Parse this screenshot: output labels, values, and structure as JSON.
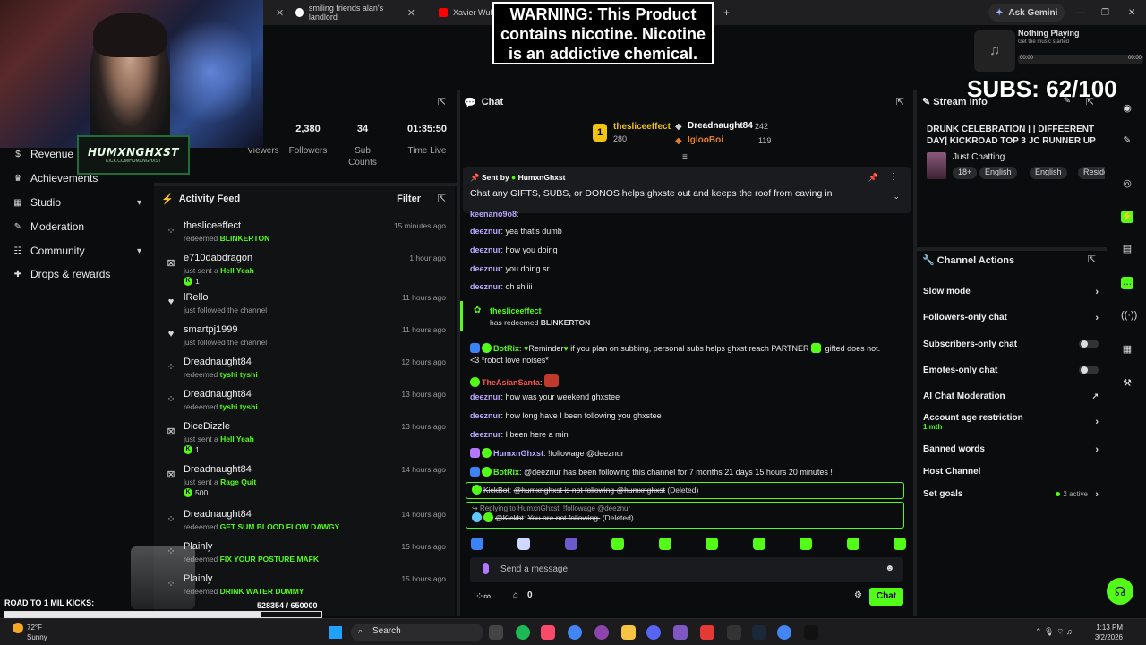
{
  "browser": {
    "tabs": [
      {
        "label": "smiling friends alan's landlord"
      },
      {
        "label": "Xavier Wulf"
      }
    ],
    "ask_gemini": "Ask Gemini"
  },
  "webcam": {
    "logo_text": "HUMXNGHXST",
    "logo_sub": "KICK.COM/HUMXNGHXST"
  },
  "warning_banner": {
    "text": "WARNING: This Product contains nicotine. Nicotine is an addictive chemical."
  },
  "music": {
    "title": "Nothing Playing",
    "subtitle": "Get the music started",
    "time_start": "00:00",
    "time_end": "00:00"
  },
  "subs_counter": "SUBS: 62/100",
  "sidebar": {
    "items": [
      {
        "label": "Revenue"
      },
      {
        "label": "Achievements"
      },
      {
        "label": "Studio"
      },
      {
        "label": "Moderation"
      },
      {
        "label": "Community"
      },
      {
        "label": "Drops & rewards"
      }
    ]
  },
  "stats": {
    "viewers_label": "Viewers",
    "followers_value": "2,380",
    "followers_label": "Followers",
    "subs_value": "34",
    "subs_label": "Sub Counts",
    "time_value": "01:35:50",
    "time_label": "Time Live"
  },
  "activity": {
    "title": "Activity Feed",
    "filter": "Filter",
    "items": [
      {
        "name": "thesliceeffect",
        "desc": "redeemed",
        "highlight": "BLINKERTON",
        "time": "15 minutes ago",
        "amount": ""
      },
      {
        "name": "e710dabdragon",
        "desc": "just sent a",
        "highlight": "Hell Yeah",
        "time": "1 hour ago",
        "amount": "1"
      },
      {
        "name": "lRello",
        "desc": "just followed the channel",
        "highlight": "",
        "time": "11 hours ago",
        "amount": ""
      },
      {
        "name": "smartpj1999",
        "desc": "just followed the channel",
        "highlight": "",
        "time": "11 hours ago",
        "amount": ""
      },
      {
        "name": "Dreadnaught84",
        "desc": "redeemed",
        "highlight": "tyshi tyshi",
        "time": "12 hours ago",
        "amount": ""
      },
      {
        "name": "Dreadnaught84",
        "desc": "redeemed",
        "highlight": "tyshi tyshi",
        "time": "13 hours ago",
        "amount": ""
      },
      {
        "name": "DiceDizzle",
        "desc": "just sent a",
        "highlight": "Hell Yeah",
        "time": "13 hours ago",
        "amount": "1"
      },
      {
        "name": "Dreadnaught84",
        "desc": "just sent a",
        "highlight": "Rage Quit",
        "time": "14 hours ago",
        "amount": "500"
      },
      {
        "name": "Dreadnaught84",
        "desc": "redeemed",
        "highlight": "GET SUM BLOOD FLOW DAWGY",
        "time": "14 hours ago",
        "amount": ""
      },
      {
        "name": "Plainly",
        "desc": "redeemed",
        "highlight": "FIX YOUR POSTURE MAFK",
        "time": "15 hours ago",
        "amount": ""
      },
      {
        "name": "Plainly",
        "desc": "redeemed",
        "highlight": "DRINK WATER DUMMY",
        "time": "15 hours ago",
        "amount": ""
      }
    ]
  },
  "road": {
    "label": "ROAD TO 1 MIL KICKS:",
    "count": "528354 / 650000",
    "progress": 0.81
  },
  "chat": {
    "title": "Chat",
    "leaderboard": [
      {
        "rank": "1",
        "name": "thesliceeffect",
        "value": "280"
      },
      {
        "name": "Dreadnaught84",
        "value": "242"
      },
      {
        "name": "IglooBoi",
        "value": "119"
      }
    ],
    "pinned": {
      "sent_by_label": "Sent by",
      "sent_by_user": "HumxnGhxst",
      "message": "Chat any GIFTS, SUBS, or DONOS helps ghxste out and keeps the roof from caving in"
    },
    "messages": [
      {
        "user": "keenano9o8",
        "text": ""
      },
      {
        "user": "deeznur",
        "text": "yea that's dumb"
      },
      {
        "user": "deeznur",
        "text": "how you doing"
      },
      {
        "user": "deeznur",
        "text": "you doing sr"
      },
      {
        "user": "deeznur",
        "text": "oh shiiii"
      }
    ],
    "redeem": {
      "user": "thesliceeffect",
      "text": "has redeemed",
      "reward": "BLINKERTON"
    },
    "botrix_reminder": {
      "user": "BotRix",
      "text": "Reminder",
      "text2": "if you plan on subbing, personal subs helps ghxst reach PARTNER",
      "text3": "gifted does not.",
      "text4": "<3 *robot love noises*"
    },
    "asian_santa": {
      "user": "TheAsianSanta"
    },
    "messages2": [
      {
        "user": "deeznur",
        "text": "how was your weekend ghxstee"
      },
      {
        "user": "deeznur",
        "text": "how long have I been following you ghxstee"
      },
      {
        "user": "deeznur",
        "text": "I been here a min"
      },
      {
        "user": "HumxnGhxst",
        "text": "!followage @deeznur"
      },
      {
        "user": "BotRix",
        "text": "@deeznur has been following this channel for 7 months 21 days 15 hours 20 minutes !"
      }
    ],
    "deleted1": {
      "user": "KickBot",
      "text": "@humxnghxst is not following @humxnghxst",
      "tag": "(Deleted)"
    },
    "deleted2": {
      "reply": "Replying to HumxnGhxst: !followage @deeznur",
      "user": "@Kickbt",
      "text": "You are not following.",
      "tag": "(Deleted)"
    },
    "send_placeholder": "Send a message",
    "footer_count": "0",
    "chat_button": "Chat"
  },
  "stream_info": {
    "title_label": "Stream Info",
    "title": "DRUNK CELEBRATION | | DIFFEERENT DAY| KICKROAD TOP 3 JC RUNNER UP ...",
    "category": "Just Chatting",
    "tags": [
      "18+",
      "English",
      "English",
      "Reside"
    ]
  },
  "channel_actions": {
    "title": "Channel Actions",
    "items": [
      {
        "label": "Slow mode",
        "sub": ""
      },
      {
        "label": "Followers-only chat",
        "sub": ""
      },
      {
        "label": "Subscribers-only chat",
        "sub": ""
      },
      {
        "label": "Emotes-only chat",
        "sub": ""
      },
      {
        "label": "AI Chat Moderation",
        "sub": ""
      },
      {
        "label": "Account age restriction",
        "sub": "1 mth"
      },
      {
        "label": "Banned words",
        "sub": ""
      },
      {
        "label": "Host Channel",
        "sub": ""
      },
      {
        "label": "Set goals",
        "sub": "",
        "status": "2 active"
      }
    ]
  },
  "taskbar": {
    "temp": "72°F",
    "weather": "Sunny",
    "search": "Search",
    "time": "1:13 PM",
    "date": "3/2/2026"
  },
  "colors": {
    "accent": "#53fc18",
    "bg": "#0b0c0d",
    "panel": "#111214"
  }
}
